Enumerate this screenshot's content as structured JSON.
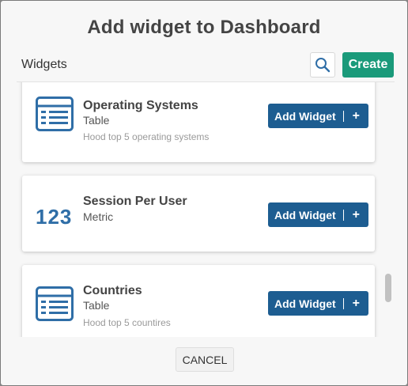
{
  "dialog": {
    "title": "Add widget to Dashboard",
    "section_label": "Widgets",
    "search_icon": "search-icon",
    "create_label": "Create",
    "cancel_label": "CANCEL"
  },
  "widgets": [
    {
      "name": "Operating Systems",
      "type": "Table",
      "description": "Hood top 5 operating systems",
      "icon": "table-icon",
      "add_label": "Add Widget",
      "add_plus": "+"
    },
    {
      "name": "Session Per User",
      "type": "Metric",
      "icon_text": "123",
      "icon": "metric-icon",
      "add_label": "Add Widget",
      "add_plus": "+"
    },
    {
      "name": "Countries",
      "type": "Table",
      "description": "Hood top 5 countires",
      "icon": "table-icon",
      "add_label": "Add Widget",
      "add_plus": "+"
    }
  ],
  "colors": {
    "accent_create": "#1a9a7a",
    "accent_add": "#1d5d91",
    "icon_blue": "#2f6ea7"
  }
}
